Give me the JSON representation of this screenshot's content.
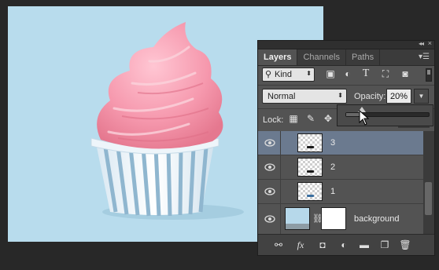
{
  "panel": {
    "tabs": [
      {
        "label": "Layers",
        "active": true
      },
      {
        "label": "Channels",
        "active": false
      },
      {
        "label": "Paths",
        "active": false
      }
    ],
    "filter": {
      "kind_label": "Kind"
    },
    "blend_mode": "Normal",
    "opacity_label": "Opacity:",
    "opacity_value": "20%",
    "opacity_fraction": 0.2,
    "lock_label": "Lock:",
    "layers": [
      {
        "name": "3",
        "selected": true
      },
      {
        "name": "2",
        "selected": false
      },
      {
        "name": "1",
        "selected": false
      },
      {
        "name": "background",
        "selected": false
      }
    ]
  },
  "icons": {
    "filter_icons": [
      "image-filter-icon",
      "adjustment-filter-icon",
      "type-filter-icon",
      "shape-filter-icon",
      "smart-object-filter-icon"
    ],
    "lock_icons": [
      "lock-transparent-pixels-icon",
      "lock-image-pixels-icon",
      "lock-position-icon"
    ],
    "footer_icons": [
      "link-layers-icon",
      "layer-style-icon",
      "add-mask-icon",
      "adjustment-layer-icon",
      "new-group-icon",
      "new-layer-icon",
      "delete-layer-icon"
    ]
  },
  "colors": {
    "canvas_bg": "#b8dced",
    "panel_bg": "#535353",
    "selected_row": "#6b7a8f",
    "frosting": "#f48fa6"
  }
}
